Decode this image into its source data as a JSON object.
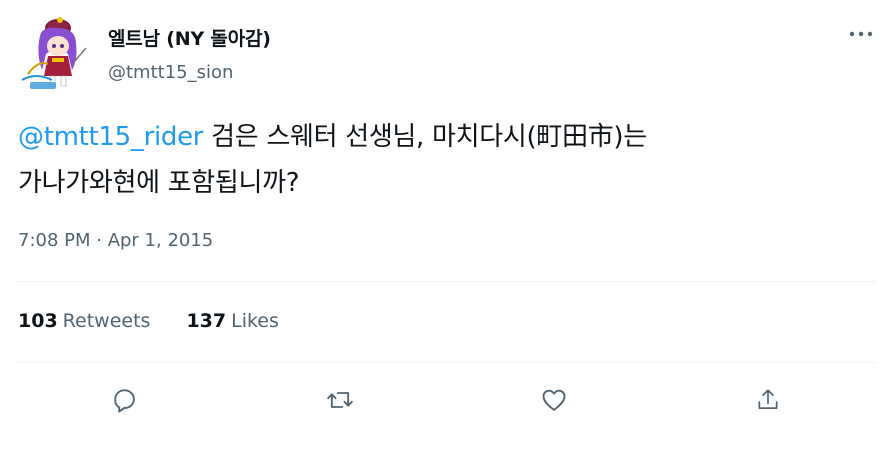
{
  "tweet": {
    "author_name": "엘트남 (NY 돌아감)",
    "author_handle": "@tmtt15_sion",
    "mention": "@tmtt15_rider",
    "text_line1": " 검은 스웨터 선생님, 마치다시(町田市)는",
    "text_line2": "가나가와현에 포함됩니까?",
    "timestamp": "7:08 PM · Apr 1, 2015",
    "retweets_count": "103",
    "retweets_label": "Retweets",
    "likes_count": "137",
    "likes_label": "Likes"
  },
  "icons": {
    "more": "more-horizontal-icon",
    "reply": "reply-icon",
    "retweet": "retweet-icon",
    "like": "heart-icon",
    "share": "share-icon"
  },
  "colors": {
    "accent": "#1d9bf0",
    "text": "#0f1419",
    "muted": "#536471",
    "divider": "#eff3f4"
  }
}
